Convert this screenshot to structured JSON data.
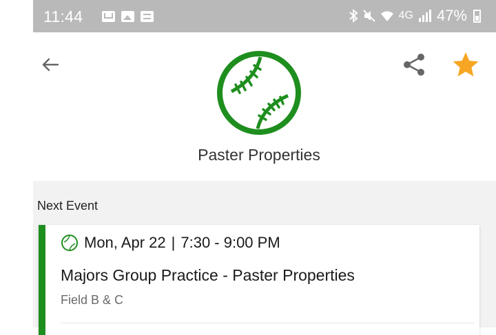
{
  "status_bar": {
    "time": "11:44",
    "network": "4G",
    "battery": "47%"
  },
  "header": {
    "team_name": "Paster Properties",
    "logo_icon": "baseball-icon",
    "logo_color": "#1e8e1e",
    "favorite_color": "#f7a623"
  },
  "next_event": {
    "section_label": "Next Event",
    "date": "Mon, Apr 22",
    "separator": "|",
    "time": "7:30 - 9:00 PM",
    "title": "Majors Group Practice - Paster Properties",
    "location": "Field B & C",
    "accent_color": "#1e8e1e"
  }
}
